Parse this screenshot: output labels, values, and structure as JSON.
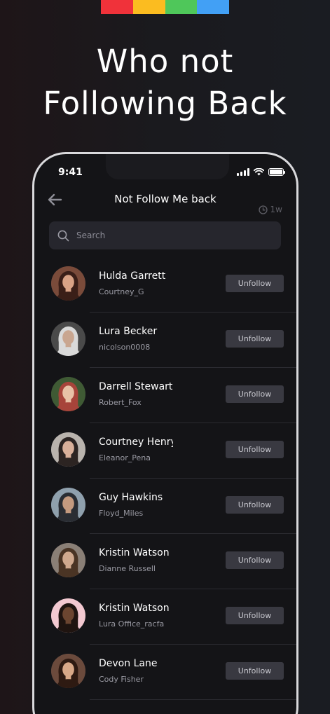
{
  "brand_bar": {
    "colors": [
      "#f0323a",
      "#fbbc20",
      "#4fc75a",
      "#42a0f5"
    ]
  },
  "headline": {
    "line1": "Who not",
    "line2": "Following Back"
  },
  "status_bar": {
    "time": "9:41"
  },
  "screen": {
    "title": "Not Follow Me back",
    "time_badge": "1w",
    "back_icon": "arrow-left-icon"
  },
  "search": {
    "placeholder": "Search",
    "value": ""
  },
  "unfollow_label": "Unfollow",
  "users": [
    {
      "name": "Hulda Garrett",
      "handle": "Courtney_G",
      "avatar_bg": "#7a4b3a",
      "avatar_skin": "#d9a386",
      "avatar_hair": "#3a1f18"
    },
    {
      "name": "Lura Becker",
      "handle": "nicolson0008",
      "avatar_bg": "#4a4a4a",
      "avatar_skin": "#c9a690",
      "avatar_hair": "#d9d9d9"
    },
    {
      "name": "Darrell Stewart",
      "handle": "Robert_Fox",
      "avatar_bg": "#3f5a34",
      "avatar_skin": "#e8c2a6",
      "avatar_hair": "#a7443a"
    },
    {
      "name": "Courtney Henry",
      "handle": "Eleanor_Pena",
      "avatar_bg": "#b9b3ad",
      "avatar_skin": "#d9b09a",
      "avatar_hair": "#2c2422"
    },
    {
      "name": "Guy Hawkins",
      "handle": "Floyd_Miles",
      "avatar_bg": "#8fa0ad",
      "avatar_skin": "#c49a7f",
      "avatar_hair": "#2a2d33"
    },
    {
      "name": "Kristin Watson",
      "handle": "Dianne Russell",
      "avatar_bg": "#8a7f76",
      "avatar_skin": "#d0a98e",
      "avatar_hair": "#4a3424"
    },
    {
      "name": "Kristin Watson",
      "handle": "Lura Office_racfa",
      "avatar_bg": "#f3c9d1",
      "avatar_skin": "#6b4530",
      "avatar_hair": "#1f1410"
    },
    {
      "name": "Devon Lane",
      "handle": "Cody Fisher",
      "avatar_bg": "#6b4a3c",
      "avatar_skin": "#d8a888",
      "avatar_hair": "#2e1a12"
    }
  ]
}
